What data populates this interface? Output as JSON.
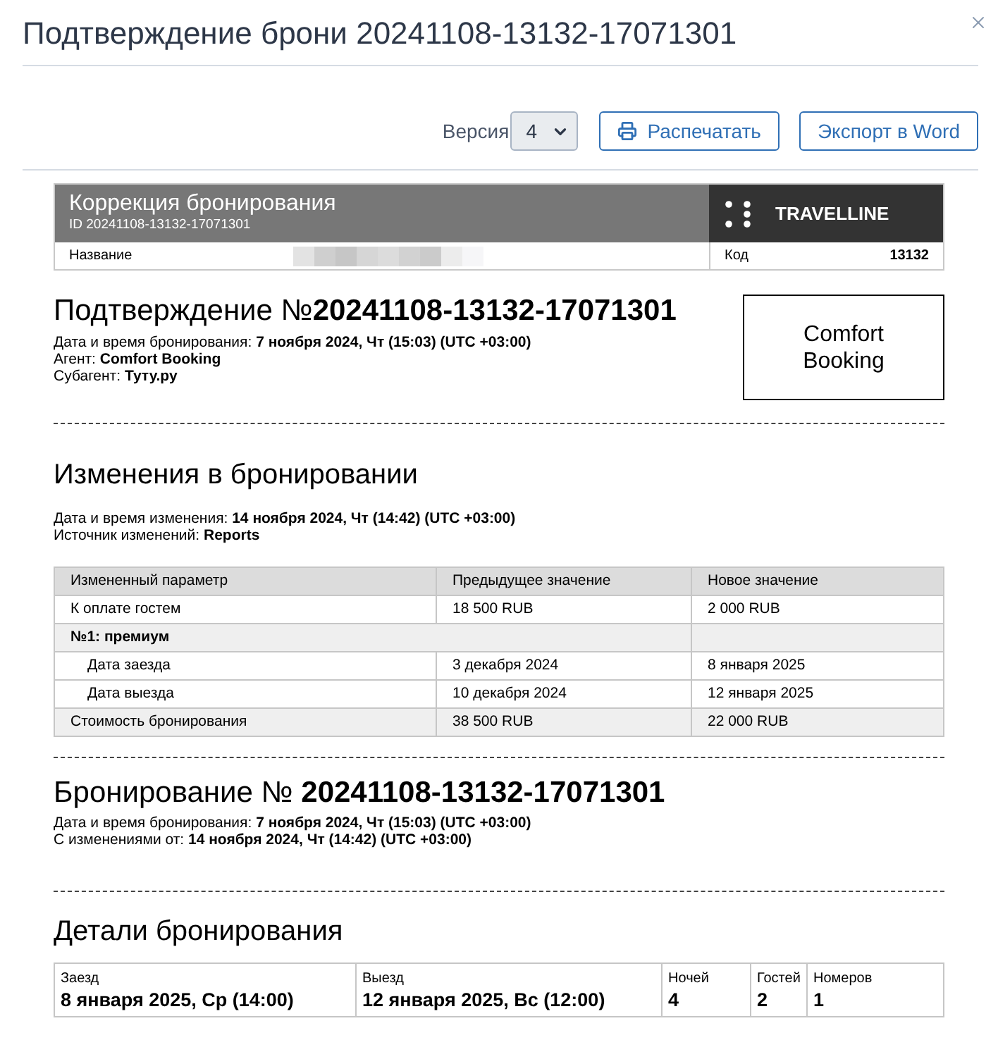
{
  "dialog": {
    "title": "Подтверждение брони 20241108-13132-17071301"
  },
  "toolbar": {
    "version": {
      "label": "Версия",
      "value": "4"
    },
    "buttons": [
      {
        "kind": "print",
        "label": "Распечатать"
      },
      {
        "kind": "export",
        "label": "Экспорт в Word"
      }
    ]
  },
  "header": {
    "title": "Коррекция бронирования",
    "id": "ID 20241108-13132-17071301",
    "logo": "TRAVELLINE",
    "name_label": "Название",
    "code_label": "Код",
    "code": "13132"
  },
  "confirmation": {
    "title": "Подтверждение №**20241108-13132-17071301**",
    "lines": [
      "Дата и время бронирования: **7 ноября 2024, Чт (15:03) (UTC +03:00)**",
      "Агент: **Comfort Booking**",
      "Субагент: **Туту.ру**"
    ],
    "agent_box": "Comfort Booking"
  },
  "changes": {
    "title": "Изменения в бронировании",
    "lines": [
      "Дата и время изменения: **14 ноября 2024, Чт (14:42) (UTC +03:00)**",
      "Источник изменений: **Reports**"
    ],
    "table": {
      "columns": [
        "Измененный параметр",
        "Предыдущее значение",
        "Новое значение"
      ],
      "rows": [
        {
          "kind": "param",
          "cells": [
            "К оплате гостем",
            "18 500 RUB",
            "2 000 RUB"
          ]
        },
        {
          "kind": "group",
          "cells": [
            {
              "text": "№1: премиум",
              "colspan": 2
            }
          ]
        },
        {
          "kind": "sub",
          "cells": [
            "Дата заезда",
            "3 декабря 2024",
            "8 января 2025"
          ]
        },
        {
          "kind": "sub",
          "cells": [
            "Дата выезда",
            "10 декабря 2024",
            "12 января 2025"
          ]
        },
        {
          "kind": "total",
          "cells": [
            "Стоимость бронирования",
            "38 500 RUB",
            "22 000 RUB"
          ]
        }
      ]
    }
  },
  "booking": {
    "title": "Бронирование № **20241108-13132-17071301**",
    "lines": [
      "Дата и время бронирования: **7 ноября 2024, Чт (15:03) (UTC +03:00)**",
      "С изменениями от: **14 ноября 2024, Чт (14:42) (UTC +03:00)**"
    ]
  },
  "details": {
    "title": "Детали бронирования",
    "fields": [
      {
        "label": "Заезд",
        "value": "8 января 2025, Ср (14:00)"
      },
      {
        "label": "Выезд",
        "value": "12 января 2025, Вс (12:00)"
      },
      {
        "label": "Ночей",
        "value": "4"
      },
      {
        "label": "Гостей",
        "value": "2"
      },
      {
        "label": "Номеров",
        "value": "1"
      }
    ]
  }
}
